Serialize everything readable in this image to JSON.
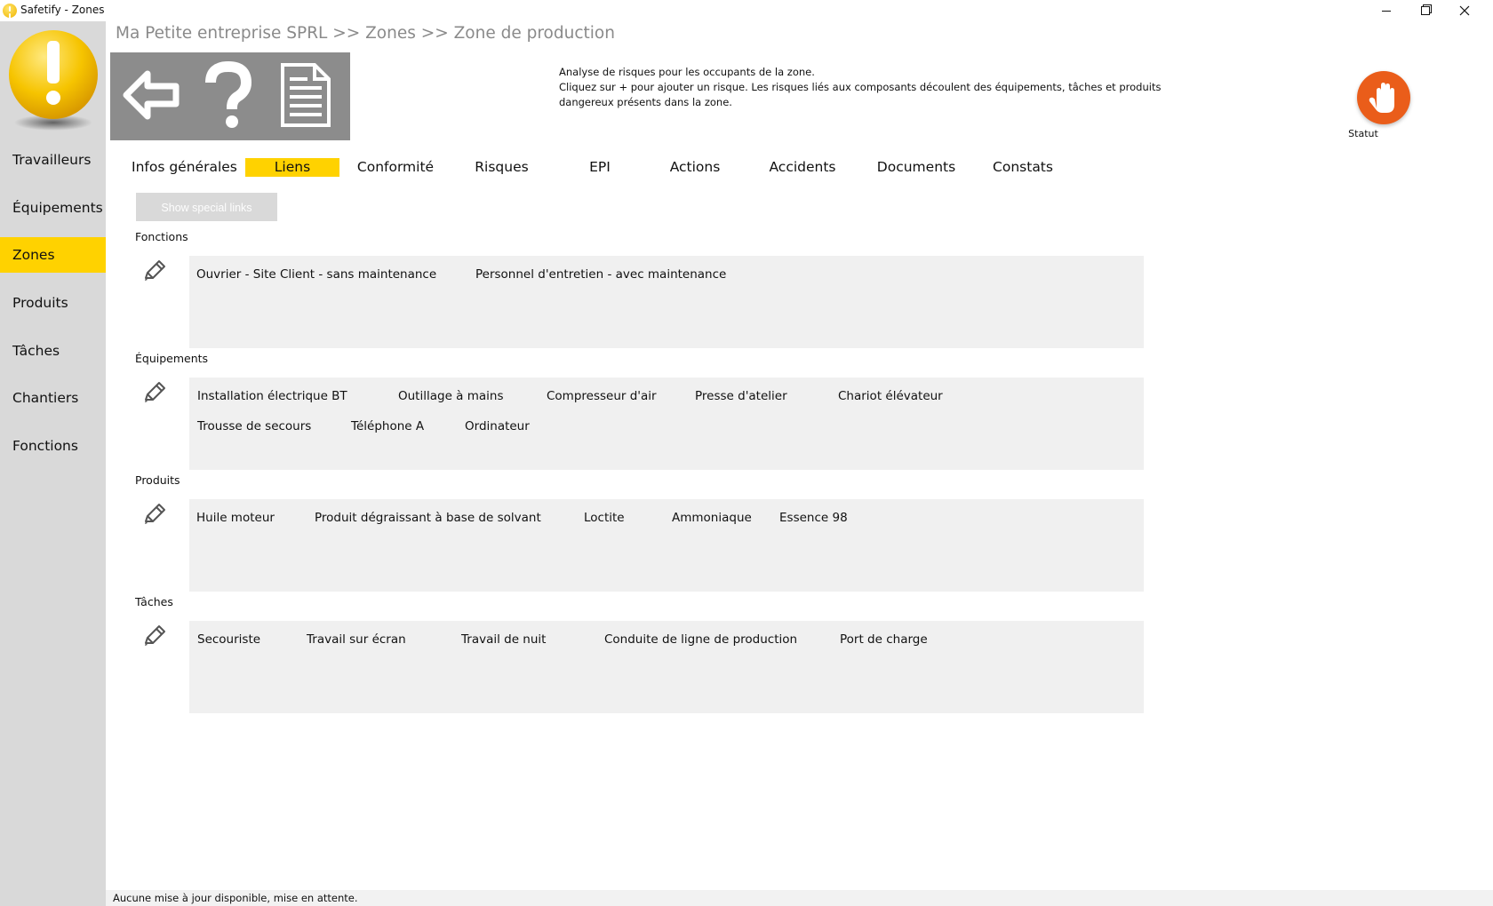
{
  "window": {
    "title": "Safetify - Zones"
  },
  "sidebar": {
    "items": [
      {
        "label": "Travailleurs",
        "active": false
      },
      {
        "label": "Équipements",
        "active": false
      },
      {
        "label": "Zones",
        "active": true
      },
      {
        "label": "Produits",
        "active": false
      },
      {
        "label": "Tâches",
        "active": false
      },
      {
        "label": "Chantiers",
        "active": false
      },
      {
        "label": "Fonctions",
        "active": false
      }
    ]
  },
  "header": {
    "breadcrumb": "Ma Petite entreprise SPRL >> Zones >> Zone de production",
    "description": [
      "Analyse de risques pour les occupants de la zone.",
      "Cliquez sur + pour ajouter un risque. Les risques liés aux composants découlent des équipements, tâches et produits",
      "dangereux présents dans la zone."
    ],
    "statut_label": "Statut"
  },
  "tabs": [
    {
      "label": "Infos générales",
      "active": false
    },
    {
      "label": "Liens",
      "active": true
    },
    {
      "label": "Conformité",
      "active": false
    },
    {
      "label": "Risques",
      "active": false
    },
    {
      "label": "EPI",
      "active": false
    },
    {
      "label": "Actions",
      "active": false
    },
    {
      "label": "Accidents",
      "active": false
    },
    {
      "label": "Documents",
      "active": false
    },
    {
      "label": "Constats",
      "active": false
    }
  ],
  "special_links_button": "Show special links",
  "sections": [
    {
      "label": "Fonctions",
      "items": [
        "Ouvrier - Site Client - sans maintenance",
        "Personnel d'entretien - avec maintenance"
      ]
    },
    {
      "label": "Équipements",
      "items": [
        "Installation électrique BT",
        "Outillage à mains",
        "Compresseur d'air",
        "Presse d'atelier",
        "Chariot élévateur",
        "Trousse de secours",
        "Téléphone A",
        "Ordinateur"
      ]
    },
    {
      "label": "Produits",
      "items": [
        "Huile moteur",
        "Produit dégraissant à base de solvant",
        "Loctite",
        "Ammoniaque",
        "Essence 98"
      ]
    },
    {
      "label": "Tâches",
      "items": [
        "Secouriste",
        "Travail sur écran",
        "Travail de nuit",
        "Conduite de ligne de production",
        "Port de charge"
      ]
    }
  ],
  "status_bar": "Aucune mise à jour disponible, mise en attente.",
  "colors": {
    "accent": "#ffd200",
    "sidebar": "#d9d9d9",
    "toolbar": "#8c8c8c",
    "statut": "#ea5d1a",
    "section_bg": "#f0f0f0"
  }
}
